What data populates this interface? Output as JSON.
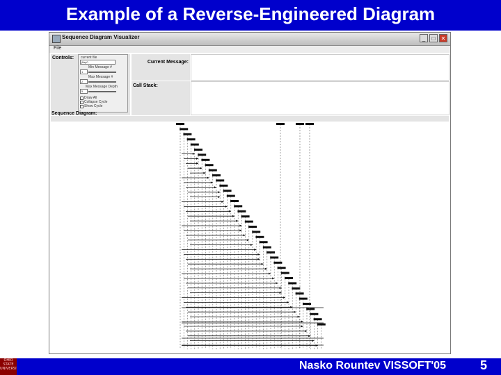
{
  "slide": {
    "title": "Example of a Reverse-Engineered Diagram",
    "footer": "Nasko Rountev VISSOFT'05",
    "page_number": "5",
    "logo_lines": [
      "OHIO",
      "STATE",
      "UNIVERSITY"
    ]
  },
  "window": {
    "title": "Sequence Diagram Visualizer",
    "menu_file": "File",
    "minimize_glyph": "_",
    "maximize_glyph": "□",
    "close_glyph": "✕"
  },
  "panels": {
    "controls_label": "Controls:",
    "current_message_label": "Current Message:",
    "call_stack_label": "Call Stack:",
    "sequence_diagram_label": "Sequence Diagram:"
  },
  "controls": {
    "current_file_label": "current file",
    "current_file_value": "jflap0",
    "min_message_label": "Min Message #",
    "min_message_value": "1",
    "max_message_label": "Max Message #",
    "max_message_value": "2",
    "max_depth_label": "Max Message Depth",
    "max_depth_value": "5",
    "option_1": "Draw All",
    "option_2": "Collapse Cycle",
    "option_3": "Show Cycle"
  },
  "colors": {
    "slide_blue": "#0000cc",
    "window_gray": "#e4e4e4",
    "diagram_ink": "#111111"
  }
}
